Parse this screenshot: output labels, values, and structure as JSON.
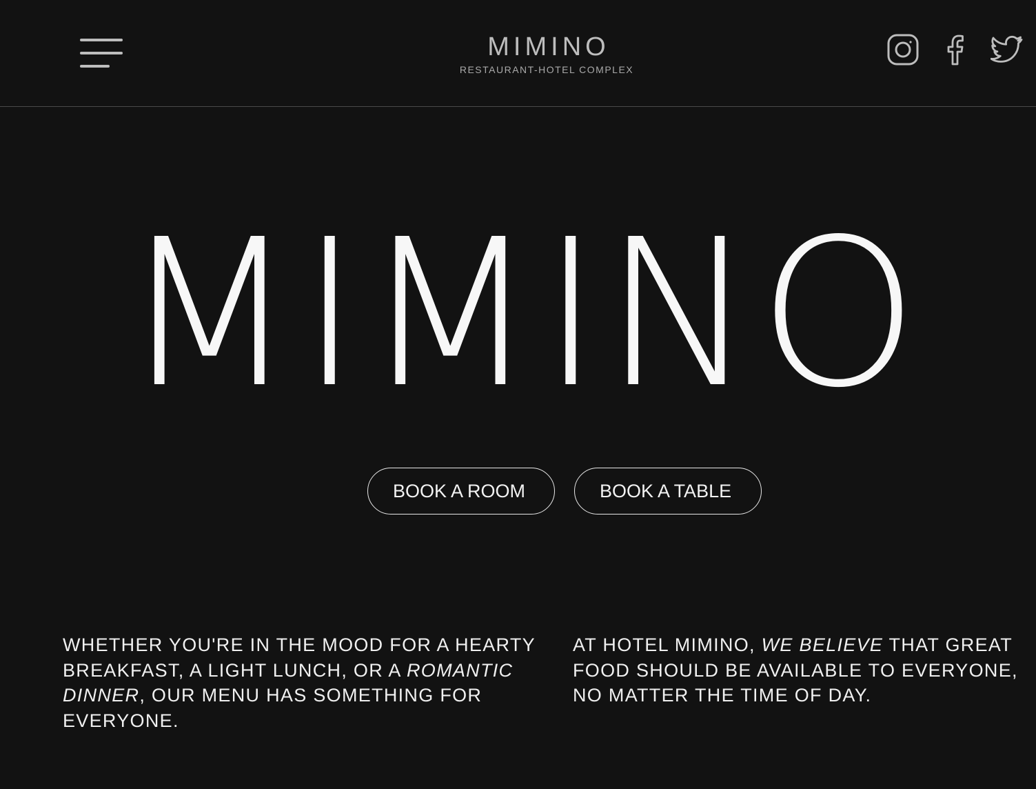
{
  "header": {
    "menu_icon": "hamburger-menu-icon",
    "brand_name": "MIMINO",
    "brand_tagline": "RESTAURANT-HOTEL COMPLEX",
    "social": [
      {
        "name": "instagram",
        "icon": "instagram-icon"
      },
      {
        "name": "facebook",
        "icon": "facebook-icon"
      },
      {
        "name": "twitter",
        "icon": "twitter-icon"
      }
    ]
  },
  "hero": {
    "title": "MIMINO",
    "buttons": {
      "book_room": "BOOK A ROOM",
      "book_table": "BOOK A TABLE"
    }
  },
  "intro": {
    "left": {
      "part1": "WHETHER YOU'RE IN THE MOOD FOR A HEARTY BREAKFAST, A LIGHT LUNCH, OR A ",
      "emphasis": "ROMANTIC DINNER",
      "part2": ", OUR MENU HAS SOMETHING FOR EVERYONE."
    },
    "right": {
      "part1": "AT HOTEL MIMINO, ",
      "emphasis": "WE BELIEVE",
      "part2": " THAT GREAT FOOD SHOULD BE AVAILABLE TO EVERYONE, NO MATTER THE TIME OF DAY."
    }
  },
  "colors": {
    "background": "#121212",
    "text": "#f5f5f5",
    "muted": "#bdbdbd",
    "divider": "#4a4a4a"
  }
}
